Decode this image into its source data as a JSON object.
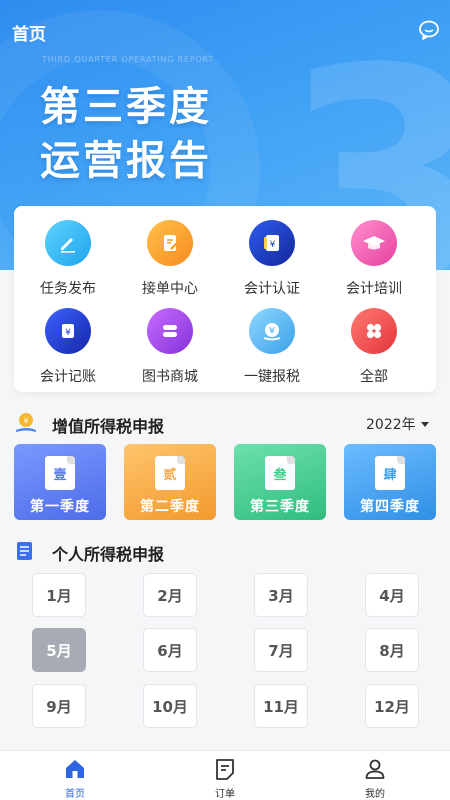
{
  "header": {
    "title": "首页"
  },
  "hero": {
    "subtitle_en": "THIRD QUARTER OPERATING REPORT",
    "title_line1": "第三季度",
    "title_line2": "运营报告",
    "deco": "3"
  },
  "services": [
    {
      "label": "任务发布",
      "icon": "edit-icon",
      "color": "#28b6f0"
    },
    {
      "label": "接单中心",
      "icon": "order-icon",
      "color": "#f59a23"
    },
    {
      "label": "会计认证",
      "icon": "ledger-icon",
      "color": "#1e3fc8"
    },
    {
      "label": "会计培训",
      "icon": "graduation-cap-icon",
      "color": "#f15bb5"
    },
    {
      "label": "会计记账",
      "icon": "yuan-icon",
      "color": "#1d3fd0"
    },
    {
      "label": "图书商城",
      "icon": "book-icon",
      "color": "#a24ee8"
    },
    {
      "label": "一键报税",
      "icon": "tax-icon",
      "color": "#3aa8ee"
    },
    {
      "label": "全部",
      "icon": "grid-icon",
      "color": "#f0484b"
    }
  ],
  "vat_section": {
    "title": "增值所得税申报",
    "year": "2022年",
    "quarters": [
      {
        "glyph": "壹",
        "label": "第一季度",
        "color": "#5b7cf0"
      },
      {
        "glyph": "贰",
        "label": "第二季度",
        "color": "#f6a742"
      },
      {
        "glyph": "叁",
        "label": "第三季度",
        "color": "#3ecb8c"
      },
      {
        "glyph": "肆",
        "label": "第四季度",
        "color": "#3ea2f0"
      }
    ]
  },
  "personal_section": {
    "title": "个人所得税申报",
    "months": [
      "1月",
      "2月",
      "3月",
      "4月",
      "5月",
      "6月",
      "7月",
      "8月",
      "9月",
      "10月",
      "11月",
      "12月"
    ],
    "selected_month": "5月"
  },
  "tabbar": {
    "items": [
      {
        "label": "首页",
        "icon": "home-icon",
        "active": true
      },
      {
        "label": "订单",
        "icon": "order-list-icon",
        "active": false
      },
      {
        "label": "我的",
        "icon": "user-icon",
        "active": false
      }
    ],
    "active_color": "#2f66e0"
  }
}
